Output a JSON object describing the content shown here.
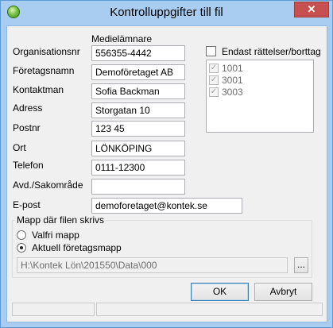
{
  "window": {
    "title": "Kontrolluppgifter till fil",
    "close_glyph": "✕"
  },
  "form": {
    "section_header": "Medielämnare",
    "fields": [
      {
        "label": "Organisationsnr",
        "value": "556355-4442"
      },
      {
        "label": "Företagsnamn",
        "value": "Demoföretaget AB"
      },
      {
        "label": "Kontaktman",
        "value": "Sofia Backman"
      },
      {
        "label": "Adress",
        "value": "Storgatan 10"
      },
      {
        "label": "Postnr",
        "value": "123 45"
      },
      {
        "label": "Ort",
        "value": "LÖNKÖPING"
      },
      {
        "label": "Telefon",
        "value": "0111-12300"
      },
      {
        "label": "Avd./Sakområde",
        "value": ""
      },
      {
        "label": "E-post",
        "value": "demoforetaget@kontek.se"
      }
    ]
  },
  "corrections": {
    "checkbox_label": "Endast rättelser/borttag",
    "checked": false,
    "list_items": [
      {
        "label": "1001",
        "checked": true
      },
      {
        "label": "3001",
        "checked": true
      },
      {
        "label": "3003",
        "checked": true
      }
    ]
  },
  "folder_group": {
    "title": "Mapp där filen skrivs",
    "options": [
      {
        "label": "Valfri mapp",
        "selected": false
      },
      {
        "label": "Aktuell företagsmapp",
        "selected": true
      }
    ],
    "path": "H:\\Kontek Lön\\201550\\Data\\000",
    "browse_label": "..."
  },
  "buttons": {
    "ok_label": "OK",
    "cancel_label": "Avbryt"
  }
}
